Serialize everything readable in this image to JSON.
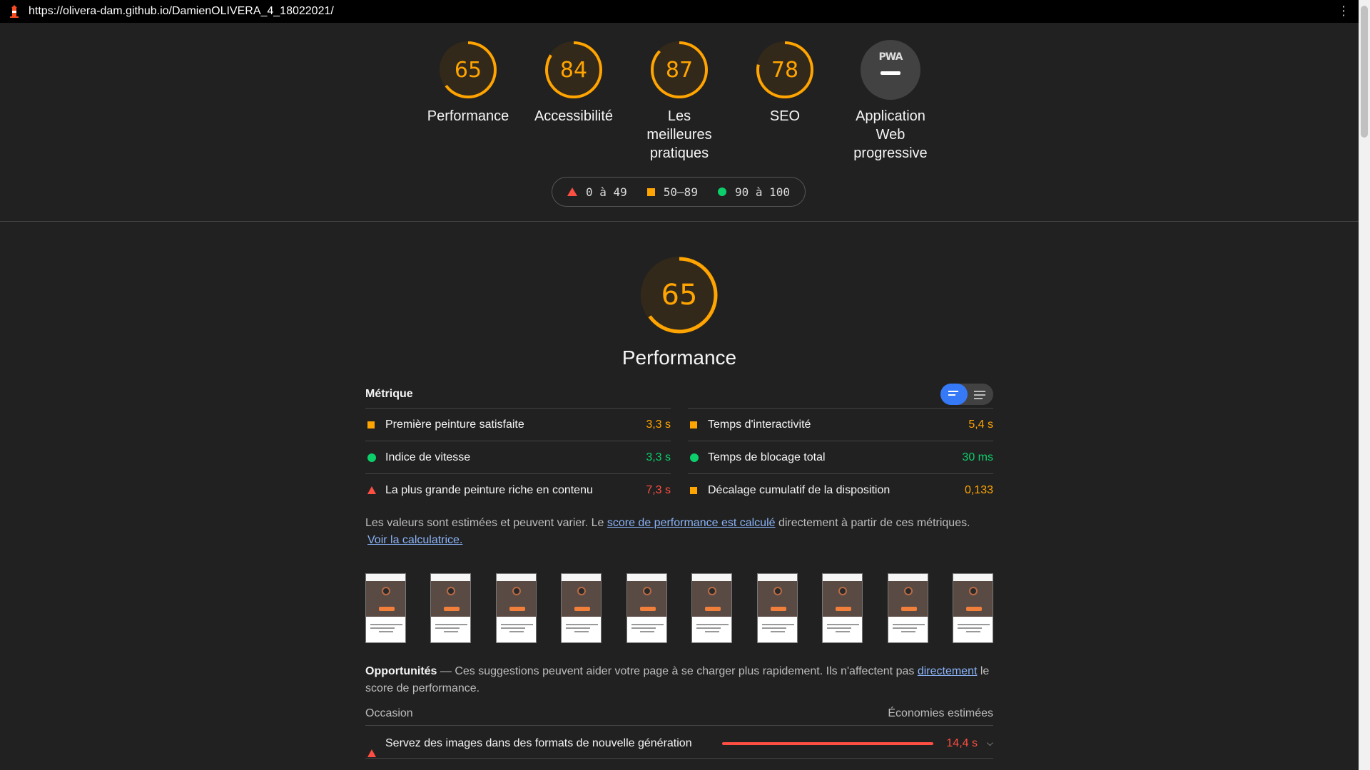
{
  "topbar": {
    "url": "https://olivera-dam.github.io/DamienOLIVERA_4_18022021/"
  },
  "colors": {
    "average": "#ffa400",
    "pass": "#0cce6b",
    "fail": "#ff4e42",
    "link": "#8ab4f8",
    "toggle_active": "#3579f6"
  },
  "gauges": [
    {
      "score": "65",
      "value": 65,
      "label": "Performance"
    },
    {
      "score": "84",
      "value": 84,
      "label": "Accessibilité"
    },
    {
      "score": "87",
      "value": 87,
      "label": "Les meilleures pratiques"
    },
    {
      "score": "78",
      "value": 78,
      "label": "SEO"
    }
  ],
  "pwa": {
    "badge": "PWA",
    "label": "Application Web progressive"
  },
  "legend": {
    "fail": "0 à 49",
    "average": "50–89",
    "pass": "90 à 100"
  },
  "performance": {
    "score": "65",
    "value": 65,
    "title": "Performance"
  },
  "metrics": {
    "title": "Métrique",
    "items": [
      {
        "name": "Première peinture satisfaite",
        "value": "3,3 s",
        "status": "average"
      },
      {
        "name": "Temps d'interactivité",
        "value": "5,4 s",
        "status": "average"
      },
      {
        "name": "Indice de vitesse",
        "value": "3,3 s",
        "status": "pass"
      },
      {
        "name": "Temps de blocage total",
        "value": "30 ms",
        "status": "pass"
      },
      {
        "name": "La plus grande peinture riche en contenu",
        "value": "7,3 s",
        "status": "fail"
      },
      {
        "name": "Décalage cumulatif de la disposition",
        "value": "0,133",
        "status": "average"
      }
    ]
  },
  "note": {
    "text1": "Les valeurs sont estimées et peuvent varier. Le ",
    "link1": "score de performance est calculé",
    "text2": " directement à partir de ces métriques.",
    "link2": "Voir la calculatrice."
  },
  "opportunities": {
    "title": "Opportunités",
    "text1": " — Ces suggestions peuvent aider votre page à se charger plus rapidement. Ils n'affectent pas ",
    "link": "directement",
    "text2": " le score de performance.",
    "col_left": "Occasion",
    "col_right": "Économies estimées",
    "rows": [
      {
        "name": "Servez des images dans des formats de nouvelle génération",
        "value": "14,4 s"
      }
    ]
  }
}
